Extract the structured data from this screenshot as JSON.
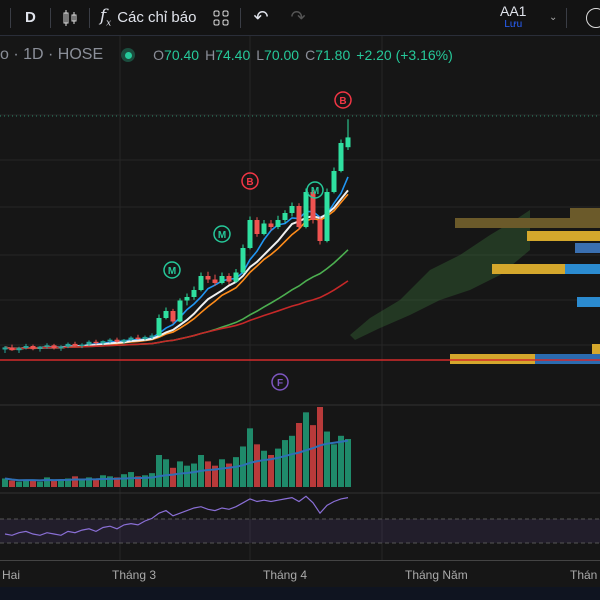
{
  "toolbar": {
    "interval": "D",
    "indicators_label": "Các chỉ báo",
    "layout_name": "AA1",
    "save_label": "Lưu"
  },
  "legend": {
    "symbol_suffix": "o · 1D · HOSE",
    "o_label": "O",
    "o": "70.40",
    "h_label": "H",
    "h": "74.40",
    "l_label": "L",
    "l": "70.00",
    "c_label": "C",
    "c": "71.80",
    "change": "+2.20 (+3.16%)"
  },
  "time_axis": [
    "Hai",
    "Tháng 3",
    "Tháng 4",
    "Tháng Năm",
    "Thán"
  ],
  "markers": [
    {
      "label": "B",
      "color": "#f23645"
    },
    {
      "label": "B",
      "color": "#f23645"
    },
    {
      "label": "M",
      "color": "#26c99a"
    },
    {
      "label": "M",
      "color": "#26c99a"
    },
    {
      "label": "M",
      "color": "#26c99a"
    },
    {
      "label": "F",
      "color": "#7e57c2"
    }
  ],
  "colors": {
    "up": "#26a69a",
    "down": "#ef5350",
    "upBright": "#2fe0a0"
  },
  "chart_data": {
    "type": "candlestick",
    "candles": [
      [
        41.5,
        42,
        41,
        41.8
      ],
      [
        41.8,
        42.2,
        41.3,
        41.4
      ],
      [
        41.4,
        41.9,
        41,
        41.7
      ],
      [
        41.7,
        42.3,
        41.5,
        42
      ],
      [
        42,
        42.2,
        41.4,
        41.6
      ],
      [
        41.6,
        42,
        41.2,
        41.9
      ],
      [
        41.9,
        42.4,
        41.6,
        42.1
      ],
      [
        42.1,
        42.3,
        41.5,
        41.7
      ],
      [
        41.7,
        42.1,
        41.3,
        41.9
      ],
      [
        41.9,
        42.5,
        41.7,
        42.3
      ],
      [
        42.3,
        42.6,
        41.9,
        42
      ],
      [
        42,
        42.4,
        41.7,
        42.2
      ],
      [
        42.2,
        42.8,
        42,
        42.6
      ],
      [
        42.6,
        42.9,
        42.2,
        42.4
      ],
      [
        42.4,
        42.8,
        42.1,
        42.7
      ],
      [
        42.7,
        43.1,
        42.4,
        42.9
      ],
      [
        42.9,
        43.2,
        42.5,
        42.6
      ],
      [
        42.6,
        43,
        42.3,
        42.9
      ],
      [
        42.9,
        43.4,
        42.7,
        43.2
      ],
      [
        43.2,
        43.6,
        42.9,
        43
      ],
      [
        43,
        43.5,
        42.8,
        43.3
      ],
      [
        43.3,
        43.8,
        43,
        43.5
      ],
      [
        43.5,
        46.5,
        43.4,
        46
      ],
      [
        46,
        47.5,
        45.8,
        47
      ],
      [
        47,
        47.3,
        45.2,
        45.5
      ],
      [
        45.5,
        48.8,
        45.4,
        48.5
      ],
      [
        48.5,
        49.5,
        47.8,
        49
      ],
      [
        49,
        50.5,
        48.6,
        50
      ],
      [
        50,
        52.5,
        49.8,
        52
      ],
      [
        52,
        52.6,
        51,
        51.5
      ],
      [
        51.5,
        52.2,
        50.6,
        51
      ],
      [
        51,
        52.5,
        50.8,
        52
      ],
      [
        52,
        52.4,
        50.8,
        51.2
      ],
      [
        51.2,
        53,
        51,
        52.5
      ],
      [
        52.5,
        56.5,
        52.3,
        56
      ],
      [
        56,
        60.5,
        55.8,
        60
      ],
      [
        60,
        60.4,
        57.6,
        58
      ],
      [
        58,
        60,
        57.8,
        59.5
      ],
      [
        59.5,
        60,
        58.5,
        59
      ],
      [
        59,
        60.6,
        58.7,
        60
      ],
      [
        60,
        61.4,
        59.6,
        61
      ],
      [
        61,
        62.5,
        60.5,
        62
      ],
      [
        62,
        62.4,
        58.6,
        59
      ],
      [
        59,
        64.5,
        58.8,
        64
      ],
      [
        64,
        64.3,
        59.5,
        60
      ],
      [
        60,
        60.5,
        56.5,
        57
      ],
      [
        57,
        64.5,
        56.8,
        64
      ],
      [
        64,
        67.5,
        63.8,
        67
      ],
      [
        67,
        71.5,
        66.8,
        71
      ],
      [
        70.4,
        74.4,
        70,
        71.8
      ]
    ],
    "volume": [
      8,
      6,
      5,
      7,
      6,
      5,
      9,
      6,
      7,
      8,
      10,
      7,
      9,
      8,
      11,
      10,
      9,
      12,
      14,
      10,
      11,
      13,
      30,
      26,
      18,
      24,
      20,
      22,
      30,
      24,
      20,
      26,
      22,
      28,
      38,
      55,
      40,
      34,
      30,
      36,
      44,
      48,
      60,
      70,
      58,
      75,
      52,
      40,
      48,
      45
    ],
    "ma_periods": {
      "blue": 5,
      "orange": 10,
      "white": 8,
      "green": 30,
      "red": 45
    },
    "rsi": [
      50,
      49,
      51,
      52,
      50,
      49,
      51,
      50,
      49,
      52,
      51,
      53,
      54,
      52,
      55,
      56,
      54,
      57,
      58,
      57,
      60,
      62,
      66,
      68,
      64,
      66,
      68,
      70,
      71,
      69,
      68,
      70,
      69,
      71,
      74,
      77,
      75,
      76,
      75,
      76,
      77,
      78,
      75,
      79,
      74,
      66,
      72,
      75,
      77,
      78
    ],
    "price_range": [
      40,
      75
    ]
  }
}
